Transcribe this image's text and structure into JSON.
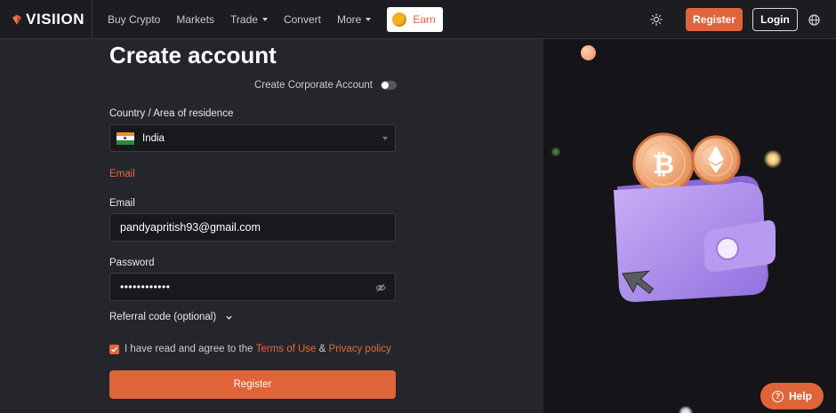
{
  "brand": {
    "name": "VISIION",
    "accent": "#e0643a"
  },
  "nav": {
    "items": [
      {
        "label": "Buy Crypto",
        "dropdown": false
      },
      {
        "label": "Markets",
        "dropdown": false
      },
      {
        "label": "Trade",
        "dropdown": true
      },
      {
        "label": "Convert",
        "dropdown": false
      },
      {
        "label": "More",
        "dropdown": true
      }
    ],
    "earn_label": "Earn",
    "register_label": "Register",
    "login_label": "Login"
  },
  "form": {
    "title": "Create account",
    "corporate_label": "Create Corporate Account",
    "corporate_enabled": false,
    "country_label": "Country / Area of residence",
    "country_value": "India",
    "email_tab": "Email",
    "email_label": "Email",
    "email_value": "pandyapritish93@gmail.com",
    "password_label": "Password",
    "password_mask": "••••••••••••",
    "referral_label": "Referral code (optional)",
    "agree_prefix": "I have read and agree to the",
    "terms_link": "Terms of Use",
    "agree_and": "&",
    "privacy_link": "Privacy policy",
    "agree_checked": true,
    "submit_label": "Register"
  },
  "help": {
    "label": "Help"
  }
}
